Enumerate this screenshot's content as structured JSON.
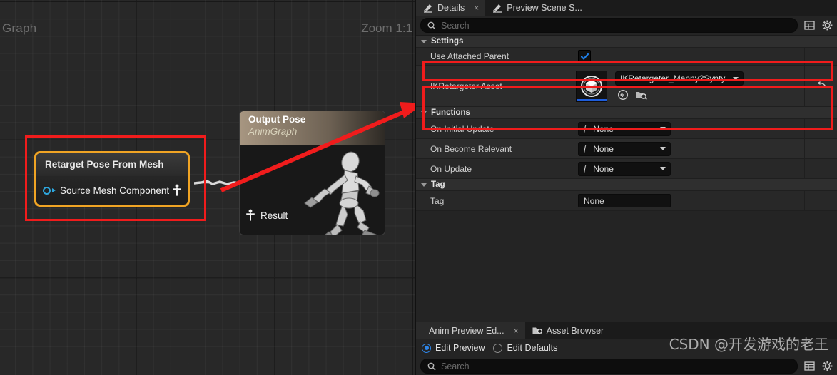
{
  "graph": {
    "title": "Graph",
    "zoom_label": "Zoom 1:1",
    "retarget_node": {
      "title": "Retarget Pose From Mesh",
      "pin_label": "Source Mesh Component"
    },
    "output_node": {
      "title": "Output Pose",
      "subtitle": "AnimGraph",
      "result_label": "Result"
    }
  },
  "details": {
    "tabs": [
      {
        "label": "Details",
        "icon": "details-pencil-icon",
        "active": true,
        "closable": true,
        "close_glyph": "×"
      },
      {
        "label": "Preview Scene S...",
        "icon": "details-pencil-icon",
        "active": false,
        "closable": false
      }
    ],
    "search": {
      "placeholder": "Search",
      "icon": "search-icon"
    },
    "toolbar_icons": [
      {
        "name": "column-layout-icon"
      },
      {
        "name": "settings-gear-icon"
      }
    ],
    "sections": [
      {
        "label": "Settings",
        "rows": [
          {
            "name": "Use Attached Parent",
            "type": "checkbox",
            "checked": true
          },
          {
            "name": "IKRetargeter Asset",
            "type": "asset",
            "value": "IKRetargeter_Manny2Synty",
            "thumbnail_icon": "asset-cube-icon",
            "buttons": [
              {
                "name": "browse-to-asset-icon"
              },
              {
                "name": "use-selected-asset-icon"
              }
            ],
            "reset_icon": "reset-to-default-icon"
          }
        ]
      },
      {
        "label": "Functions",
        "rows": [
          {
            "name": "On Initial Update",
            "type": "function",
            "value": "None",
            "fn_glyph": "ƒ"
          },
          {
            "name": "On Become Relevant",
            "type": "function",
            "value": "None",
            "fn_glyph": "ƒ"
          },
          {
            "name": "On Update",
            "type": "function",
            "value": "None",
            "fn_glyph": "ƒ"
          }
        ]
      },
      {
        "label": "Tag",
        "rows": [
          {
            "name": "Tag",
            "type": "text",
            "value": "None"
          }
        ]
      }
    ]
  },
  "bottom_panel": {
    "tabs": [
      {
        "label": "Anim Preview Ed...",
        "active": true,
        "closable": true,
        "close_glyph": "×"
      },
      {
        "label": "Asset Browser",
        "icon": "asset-browser-icon",
        "active": false,
        "closable": false
      }
    ],
    "radios": [
      {
        "label": "Edit Preview",
        "selected": true
      },
      {
        "label": "Edit Defaults",
        "selected": false
      }
    ],
    "search": {
      "placeholder": "Search",
      "icon": "search-icon"
    }
  },
  "watermark": {
    "text": "CSDN @开发游戏的老王"
  },
  "colors": {
    "annotation_red": "#f01c1c",
    "node_selected_orange": "#f0a424",
    "accent_blue": "#2f86e8",
    "pin_blue": "#2ea6dd",
    "panel_bg": "#242424",
    "graph_bg": "#282828"
  }
}
